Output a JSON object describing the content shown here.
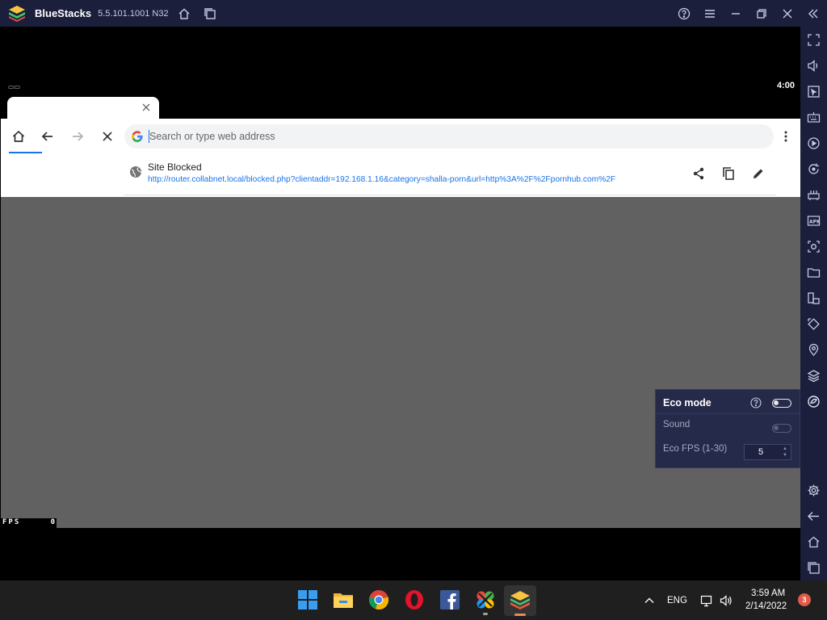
{
  "titlebar": {
    "app_name": "BlueStacks",
    "version": "5.5.101.1001 N32"
  },
  "android": {
    "status_time": "4:00",
    "fps_label": "FPS",
    "fps_value": "0"
  },
  "browser": {
    "search_placeholder": "Search or type web address",
    "suggestion": {
      "title": "Site Blocked",
      "url": "http://router.collabnet.local/blocked.php?clientaddr=192.168.1.16&category=shalla-porn&url=http%3A%2F%2Fpornhub.com%2F"
    }
  },
  "eco_popup": {
    "title": "Eco mode",
    "sound_label": "Sound",
    "fps_label": "Eco FPS (1-30)",
    "fps_value": "5",
    "eco_enabled": false,
    "sound_enabled": false
  },
  "taskbar": {
    "language": "ENG",
    "time": "3:59 AM",
    "date": "2/14/2022",
    "notification_count": "3"
  },
  "colors": {
    "frame": "#1b1f3b",
    "accent": "#1a73e8",
    "page_gray": "#616161",
    "popup": "#262a4a"
  }
}
